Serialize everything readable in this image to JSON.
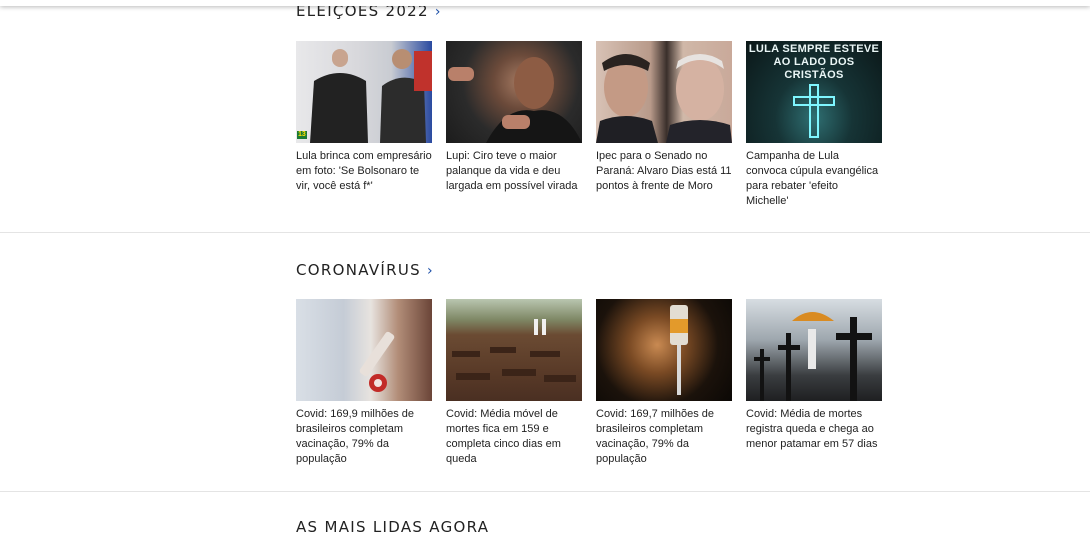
{
  "sections": [
    {
      "title": "ELEIÇÕES 2022",
      "chevron": "›",
      "cards": [
        {
          "title": "Lula brinca com empresário em foto: 'Se Bolsonaro te vir, você está f*'",
          "image": "lula-empresario-photo",
          "badge": "13"
        },
        {
          "title": "Lupi: Ciro teve o maior palanque da vida e deu largada em possível virada",
          "image": "lupi-photo"
        },
        {
          "title": "Ipec para o Senado no Paraná: Alvaro Dias está 11 pontos à frente de Moro",
          "image": "moro-alvaro-photo"
        },
        {
          "title": "Campanha de Lula convoca cúpula evangélica para rebater 'efeito Michelle'",
          "image": "lula-cross-poster",
          "overlay": "LULA SEMPRE ESTEVE AO LADO DOS CRISTÃOS"
        }
      ]
    },
    {
      "title": "CORONAVÍRUS",
      "chevron": "›",
      "cards": [
        {
          "title": "Covid: 169,9 milhões de brasileiros completam vacinação, 79% da população",
          "image": "vaccine-syringe-photo"
        },
        {
          "title": "Covid: Média móvel de mortes fica em 159 e completa cinco dias em queda",
          "image": "cemetery-graves-photo"
        },
        {
          "title": "Covid: 169,7 milhões de brasileiros completam vacinação, 79% da população",
          "image": "vaccine-vial-photo"
        },
        {
          "title": "Covid: Média de mortes registra queda e chega ao menor patamar em 57 dias",
          "image": "cemetery-crosses-photo"
        }
      ]
    },
    {
      "title": "AS MAIS LIDAS AGORA"
    }
  ]
}
